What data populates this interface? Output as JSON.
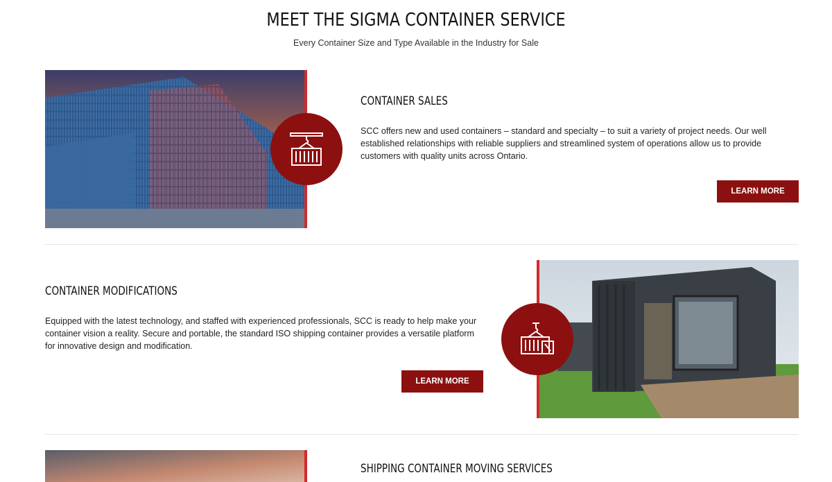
{
  "header": {
    "title": "MEET THE SIGMA CONTAINER SERVICE",
    "subtitle": "Every Container Size and Type Available in the Industry for Sale"
  },
  "services": [
    {
      "title": "CONTAINER SALES",
      "description": "SCC offers new and used containers – standard and specialty – to suit a variety of project needs. Our well established relationships with reliable suppliers and streamlined system of operations allow us to provide customers with quality units across Ontario.",
      "button": "LEARN MORE",
      "icon": "container-crane-icon"
    },
    {
      "title": "CONTAINER MODIFICATIONS",
      "description": "Equipped with the latest technology, and staffed with experienced professionals, SCC is ready to help make your container vision a reality. Secure and portable, the standard ISO shipping container provides a versatile platform for innovative design and modification.",
      "button": "LEARN MORE",
      "icon": "container-modification-icon"
    },
    {
      "title": "SHIPPING CONTAINER MOVING SERVICES"
    }
  ],
  "colors": {
    "accent": "#8c1010",
    "bar": "#d02b2b"
  }
}
